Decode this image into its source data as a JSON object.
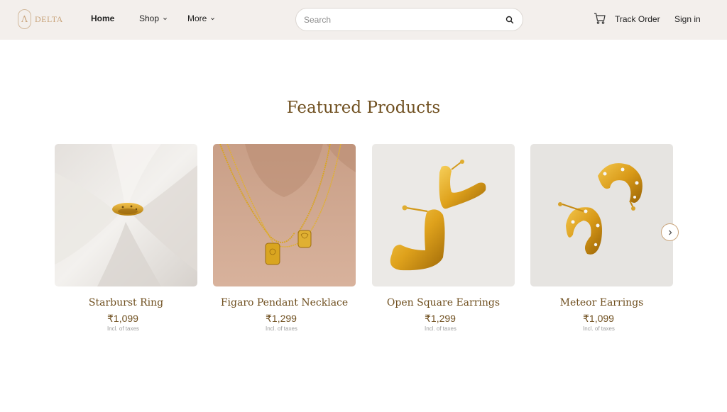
{
  "header": {
    "logo_text": "DELTA",
    "logo_mark": "Λ",
    "nav": {
      "home": "Home",
      "shop": "Shop",
      "more": "More"
    },
    "search_placeholder": "Search",
    "track_order": "Track Order",
    "sign_in": "Sign in"
  },
  "section_title": "Featured Products",
  "products": [
    {
      "name": "Starburst Ring",
      "price": "₹1,099",
      "tax_note": "Incl. of taxes"
    },
    {
      "name": "Figaro Pendant Necklace",
      "price": "₹1,299",
      "tax_note": "Incl. of taxes"
    },
    {
      "name": "Open Square Earrings",
      "price": "₹1,299",
      "tax_note": "Incl. of taxes"
    },
    {
      "name": "Meteor Earrings",
      "price": "₹1,099",
      "tax_note": "Incl. of taxes"
    }
  ],
  "icons": {
    "search": "search-icon",
    "cart": "cart-icon",
    "next": "chevron-right-icon",
    "dropdown": "chevron-down-icon"
  },
  "colors": {
    "header_bg": "#f3efec",
    "accent_brown": "#6f4f1f",
    "logo_gold": "#c9a47b",
    "gold": "#d9a520"
  }
}
